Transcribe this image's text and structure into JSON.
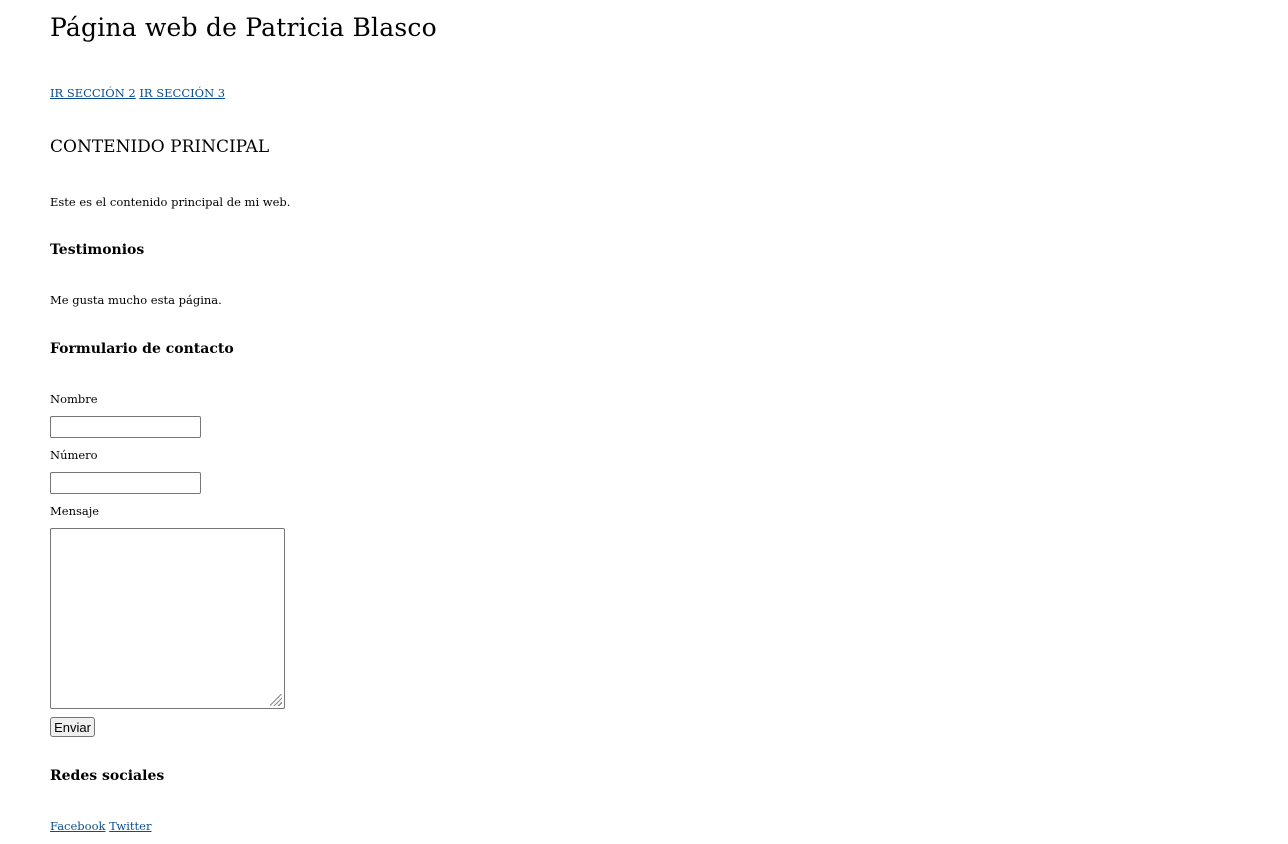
{
  "header": {
    "title": "Página web de Patricia Blasco"
  },
  "navigation": {
    "links": [
      "IR SECCIÓN 2",
      "IR SECCIÓN 3"
    ]
  },
  "main": {
    "heading": "CONTENIDO PRINCIPAL",
    "text": "Este es el contenido principal de mi web."
  },
  "testimonials": {
    "heading": "Testimonios",
    "text": "Me gusta mucho esta página."
  },
  "contact_form": {
    "heading": "Formulario de contacto",
    "name_label": "Nombre",
    "name_value": "",
    "number_label": "Número",
    "number_value": "",
    "message_label": "Mensaje",
    "message_value": "",
    "submit_label": "Enviar"
  },
  "social": {
    "heading": "Redes sociales",
    "links": [
      "Facebook",
      "Twitter"
    ]
  },
  "colors": {
    "link": "#0b4f8a",
    "text": "#000000",
    "background": "#ffffff"
  }
}
